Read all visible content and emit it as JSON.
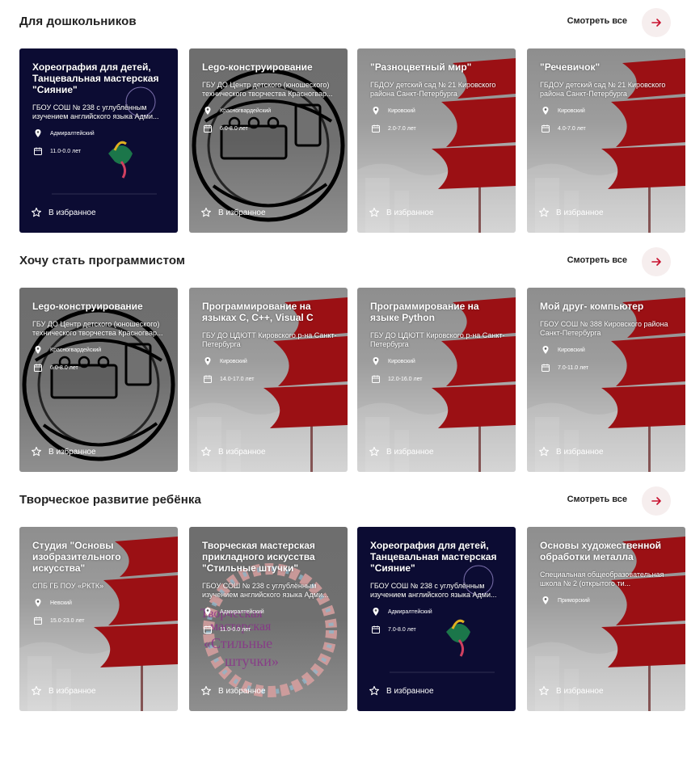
{
  "see_all_label": "Смотреть все",
  "favorite_label": "В избранное",
  "sections": [
    {
      "title": "Для дошкольников",
      "cards": [
        {
          "title": "Хореография для детей, Танцевальная мастерская \"Сияние\"",
          "org": "ГБОУ СОШ № 238 с углублённым изучением английского языка Адми...",
          "district": "Адмиралтейский",
          "age": "11.0-0.0 лет",
          "style": "navy"
        },
        {
          "title": "Lego-конструирование",
          "org": "ГБУ ДО Центр детского (юношеского) технического творчества Красногвар...",
          "district": "Красногвардейский",
          "age": "6.0-8.0 лет",
          "style": "dark-gray"
        },
        {
          "title": "\"Разноцветный мир\"",
          "org": "ГБДОУ детский сад № 21 Кировского района Санкт-Петербурга",
          "district": "Кировский",
          "age": "2.0-7.0 лет",
          "style": "gray"
        },
        {
          "title": "\"Речевичок\"",
          "org": "ГБДОУ детский сад № 21 Кировского района Санкт-Петербурга",
          "district": "Кировский",
          "age": "4.0-7.0 лет",
          "style": "gray"
        }
      ]
    },
    {
      "title": "Хочу стать программистом",
      "cards": [
        {
          "title": "Lego-конструирование",
          "org": "ГБУ ДО Центр детского (юношеского) технического творчества Красногвар...",
          "district": "Красногвардейский",
          "age": "6.0-8.0 лет",
          "style": "dark-gray"
        },
        {
          "title": "Программирование на языках C, C++, Visual C",
          "org": "ГБУ ДО ЦДЮТТ Кировского р-на Санкт-Петербурга",
          "district": "Кировский",
          "age": "14.0-17.0 лет",
          "style": "gray"
        },
        {
          "title": "Программирование на языке Python",
          "org": "ГБУ ДО ЦДЮТТ Кировского р-на Санкт-Петербурга",
          "district": "Кировский",
          "age": "12.0-16.0 лет",
          "style": "gray"
        },
        {
          "title": "Мой друг- компьютер",
          "org": "ГБОУ СОШ № 388 Кировского района Санкт-Петербурга",
          "district": "Кировский",
          "age": "7.0-11.0 лет",
          "style": "gray"
        }
      ]
    },
    {
      "title": "Творческое развитие ребёнка",
      "cards": [
        {
          "title": "Студия \"Основы изобразительного искусства\"",
          "org": "СПБ ГБ ПОУ «РКТК»",
          "district": "Невский",
          "age": "15.0-23.0 лет",
          "style": "gray"
        },
        {
          "title": "Творческая мастерская прикладного искусства \"Стильные штучки\"",
          "org": "ГБОУ СОШ № 238 с углублённым изучением английского языка Адми...",
          "district": "Адмиралтейский",
          "age": "11.0-0.0 лет",
          "style": "dark-gray"
        },
        {
          "title": "Хореография для детей, Танцевальная мастерская \"Сияние\"",
          "org": "ГБОУ СОШ № 238 с углублённым изучением английского языка Адми...",
          "district": "Адмиралтейский",
          "age": "7.0-8.0 лет",
          "style": "navy"
        },
        {
          "title": "Основы художественной обработки металла",
          "org": "Специальная общеобразовательная школа № 2 (открытого ти...",
          "district": "Приморский",
          "age": "",
          "style": "gray"
        }
      ]
    }
  ],
  "colors": {
    "accent": "#c8102e",
    "sail": "#9b1014",
    "navy": "#0c0c33"
  },
  "icons": {
    "see_all": "arrow-right-icon",
    "district": "location-pin-icon",
    "age": "calendar-icon",
    "favorite": "star-outline-icon"
  }
}
